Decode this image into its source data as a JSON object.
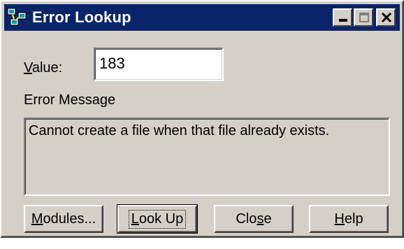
{
  "window": {
    "title": "Error Lookup",
    "app_icon": "network-computers-icon",
    "caption_buttons": [
      "minimize-icon",
      "maximize-icon",
      "close-icon"
    ],
    "title_bar_color": "#0a246a",
    "face_color": "#d4d0c8"
  },
  "form": {
    "value_label_prefix": "",
    "value_label_accel": "V",
    "value_label_rest": "alue:",
    "value": "183",
    "error_message_label": "Error Message",
    "error_message": "Cannot create a file when that file already exists."
  },
  "buttons": {
    "modules": {
      "accel": "M",
      "rest": "odules..."
    },
    "lookup": {
      "accel": "L",
      "pre": "",
      "rest": "ook Up"
    },
    "close": {
      "pre": "Clo",
      "accel": "s",
      "rest": "e"
    },
    "help": {
      "accel": "H",
      "rest": "elp"
    }
  }
}
